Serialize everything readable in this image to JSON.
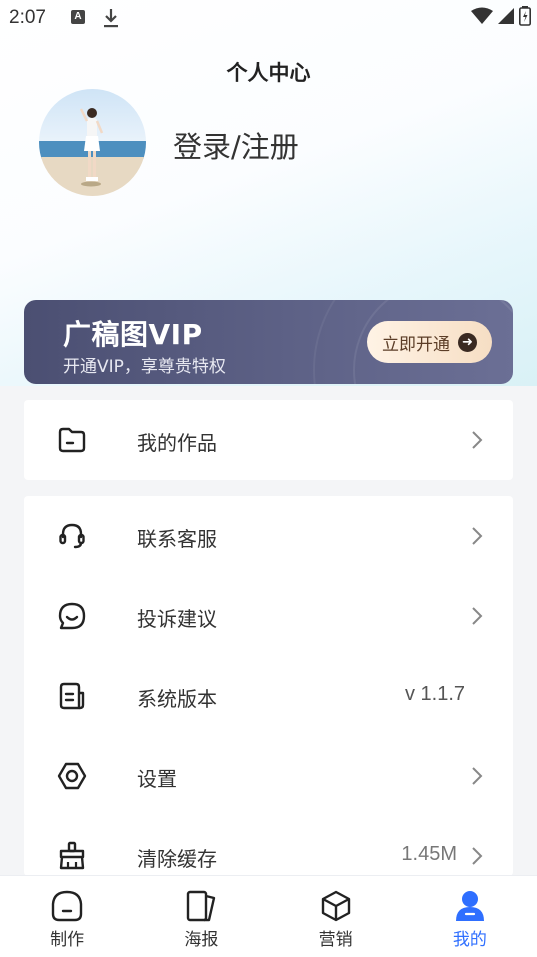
{
  "status_bar": {
    "time": "2:07",
    "notification_letter": "A"
  },
  "header": {
    "title": "个人中心"
  },
  "profile": {
    "login_label": "登录/注册"
  },
  "vip": {
    "title": "广稿图VIP",
    "subtitle": "开通VIP，享尊贵特权",
    "button_label": "立即开通"
  },
  "menu_primary": [
    {
      "label": "我的作品",
      "icon": "folder-icon"
    }
  ],
  "menu_secondary": [
    {
      "label": "联系客服",
      "icon": "headset-icon"
    },
    {
      "label": "投诉建议",
      "icon": "chat-smile-icon"
    },
    {
      "label": "系统版本",
      "icon": "document-icon",
      "value": "v 1.1.7"
    },
    {
      "label": "设置",
      "icon": "settings-hex-icon"
    },
    {
      "label": "清除缓存",
      "icon": "broom-icon",
      "value": "1.45M"
    }
  ],
  "tabs": [
    {
      "label": "制作",
      "icon": "create-icon"
    },
    {
      "label": "海报",
      "icon": "poster-icon"
    },
    {
      "label": "营销",
      "icon": "cube-icon"
    },
    {
      "label": "我的",
      "icon": "user-icon",
      "active": true
    }
  ],
  "colors": {
    "accent": "#2f6fff",
    "vip_bg": "#4b4f72",
    "vip_button": "#f6dec4"
  }
}
